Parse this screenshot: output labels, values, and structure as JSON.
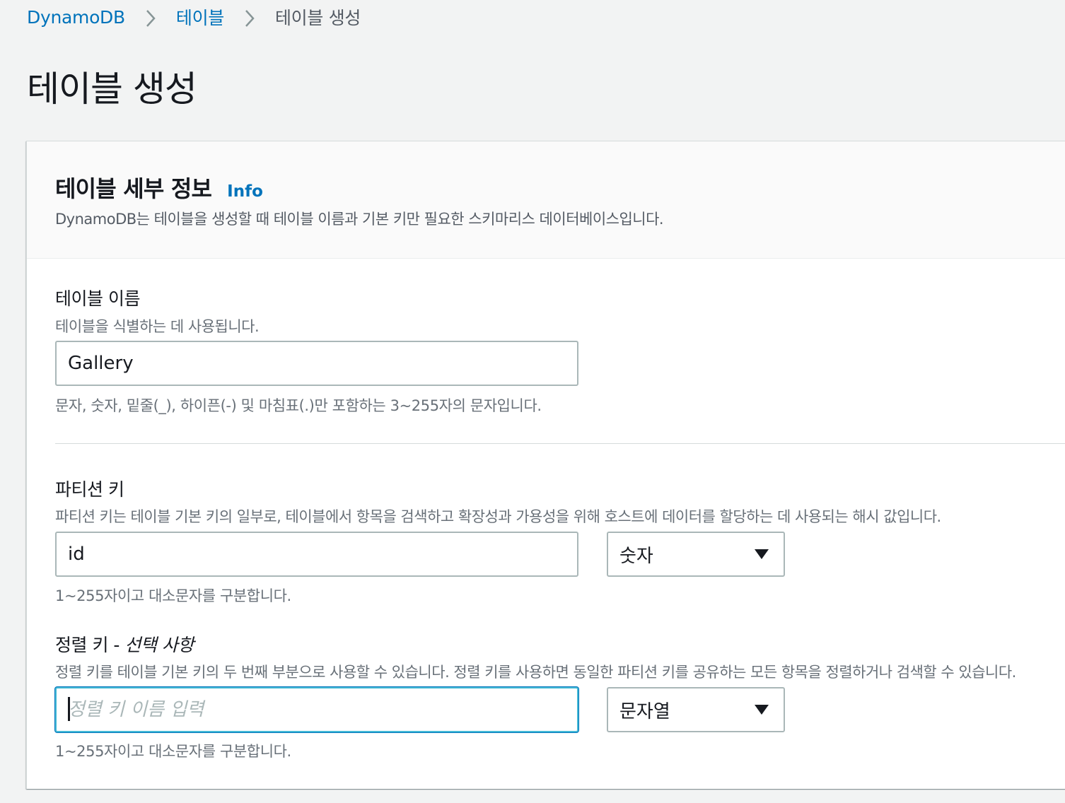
{
  "breadcrumb": {
    "items": [
      "DynamoDB",
      "테이블",
      "테이블 생성"
    ]
  },
  "page_title": "테이블 생성",
  "panel": {
    "title": "테이블 세부 정보",
    "info_label": "Info",
    "description": "DynamoDB는 테이블을 생성할 때 테이블 이름과 기본 키만 필요한 스키마리스 데이터베이스입니다."
  },
  "table_name": {
    "label": "테이블 이름",
    "description": "테이블을 식별하는 데 사용됩니다.",
    "value": "Gallery",
    "constraint": "문자, 숫자, 밑줄(_), 하이픈(-) 및 마침표(.)만 포함하는 3~255자의 문자입니다."
  },
  "partition_key": {
    "label": "파티션 키",
    "description": "파티션 키는 테이블 기본 키의 일부로, 테이블에서 항목을 검색하고 확장성과 가용성을 위해 호스트에 데이터를 할당하는 데 사용되는 해시 값입니다.",
    "value": "id",
    "type_selected": "숫자",
    "constraint": "1~255자이고 대소문자를 구분합니다."
  },
  "sort_key": {
    "label": "정렬 키 - ",
    "label_optional": "선택 사항",
    "description": "정렬 키를 테이블 기본 키의 두 번째 부분으로 사용할 수 있습니다. 정렬 키를 사용하면 동일한 파티션 키를 공유하는 모든 항목을 정렬하거나 검색할 수 있습니다.",
    "placeholder": "정렬 키 이름 입력",
    "type_selected": "문자열",
    "constraint": "1~255자이고 대소문자를 구분합니다."
  },
  "icons": {
    "breadcrumb_separator": "chevron-right-icon",
    "select_arrow": "caret-down-icon"
  },
  "colors": {
    "link": "#0073bb",
    "focus": "#44b9d6",
    "background": "#f2f3f3"
  }
}
